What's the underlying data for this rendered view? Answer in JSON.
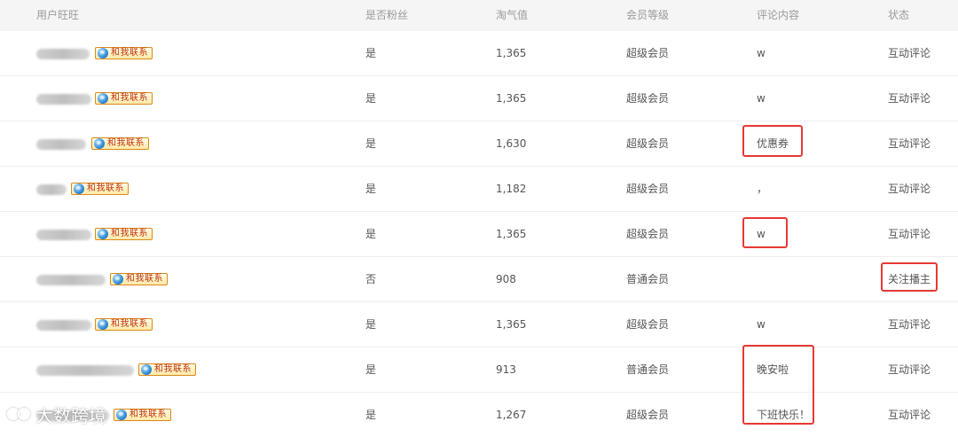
{
  "header": {
    "user": "用户旺旺",
    "is_fan": "是否粉丝",
    "taoqi": "淘气值",
    "level": "会员等级",
    "comment": "评论内容",
    "status": "状态"
  },
  "badge_label": "和我联系",
  "watermark": "大数跨境",
  "rows": [
    {
      "is_fan": "是",
      "taoqi": "1,365",
      "level": "超级会员",
      "comment": "w",
      "status": "互动评论"
    },
    {
      "is_fan": "是",
      "taoqi": "1,365",
      "level": "超级会员",
      "comment": "w",
      "status": "互动评论"
    },
    {
      "is_fan": "是",
      "taoqi": "1,630",
      "level": "超级会员",
      "comment": "优惠券",
      "status": "互动评论"
    },
    {
      "is_fan": "是",
      "taoqi": "1,182",
      "level": "超级会员",
      "comment": "，",
      "status": "互动评论"
    },
    {
      "is_fan": "是",
      "taoqi": "1,365",
      "level": "超级会员",
      "comment": "w",
      "status": "互动评论"
    },
    {
      "is_fan": "否",
      "taoqi": "908",
      "level": "普通会员",
      "comment": "",
      "status": "关注播主"
    },
    {
      "is_fan": "是",
      "taoqi": "1,365",
      "level": "超级会员",
      "comment": "w",
      "status": "互动评论"
    },
    {
      "is_fan": "是",
      "taoqi": "913",
      "level": "普通会员",
      "comment": "晚安啦",
      "status": "互动评论"
    },
    {
      "is_fan": "是",
      "taoqi": "1,267",
      "level": "超级会员",
      "comment": "下班快乐！",
      "status": "互动评论"
    }
  ],
  "colors": {
    "highlight": "#e53935",
    "header_bg": "#f5f5f5",
    "badge_text": "#c0350d"
  }
}
